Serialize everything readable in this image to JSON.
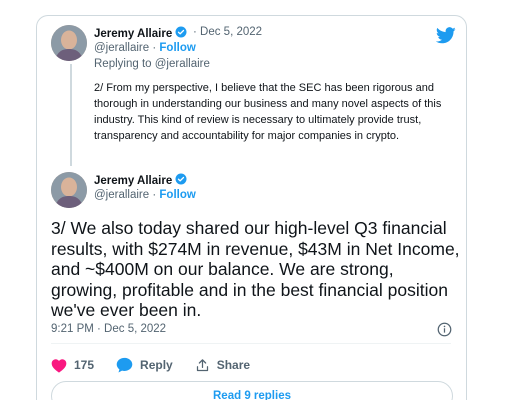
{
  "first_tweet": {
    "name": "Jeremy Allaire",
    "date": "· Dec 5, 2022",
    "handle": "@jerallaire",
    "separator": "·",
    "follow": "Follow",
    "replying_prefix": "Replying to",
    "replying_handle": "@jerallaire",
    "text": "2/ From my perspective, I believe that the SEC has been rigorous and thorough in understanding our business and many novel aspects of this industry.  This kind of review is necessary to ultimately provide trust, transparency and accountability for major companies in crypto."
  },
  "main_tweet": {
    "name": "Jeremy Allaire",
    "handle": "@jerallaire",
    "separator": "·",
    "follow": "Follow",
    "text": "3/ We also today shared our high-level Q3 financial results, with $274M in revenue, $43M in Net Income, and ~$400M on our balance.  We are strong, growing, profitable and in the best financial position we've ever been in.",
    "timestamp": "9:21 PM · Dec 5, 2022"
  },
  "actions": {
    "like_count": "175",
    "reply_label": "Reply",
    "share_label": "Share"
  },
  "read_replies": "Read 9 replies",
  "icons": {
    "brand": "twitter-bird-icon",
    "verified": "verified-badge-icon",
    "like": "heart-icon",
    "reply": "reply-bubble-icon",
    "share": "share-icon",
    "info": "info-icon"
  },
  "colors": {
    "accent": "#1d9bf0",
    "like": "#f91880",
    "text": "#0f1419",
    "muted": "#536471",
    "border": "#cfd9de"
  }
}
